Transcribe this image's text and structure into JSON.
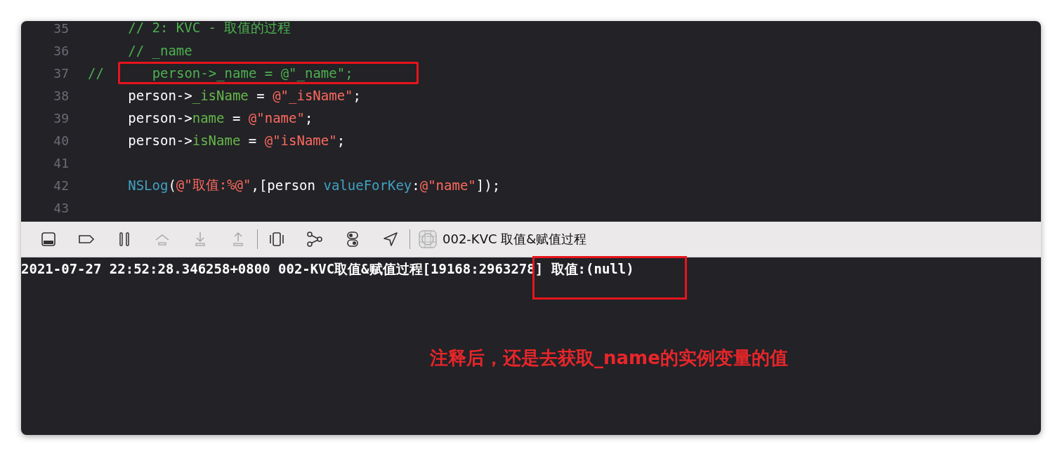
{
  "editor": {
    "lines": [
      {
        "number": "35",
        "tokens": [
          {
            "text": "     // 2: KVC - 取值的过程",
            "kind": "comment",
            "boxed": false
          }
        ]
      },
      {
        "number": "36",
        "tokens": [
          {
            "text": "     // _name",
            "kind": "comment",
            "boxed": false
          }
        ]
      },
      {
        "number": "37",
        "tokens": [
          {
            "text": "//",
            "kind": "comment",
            "boxed": false
          },
          {
            "text": "    person->_name = @\"_name\";",
            "kind": "comment",
            "boxed": true
          }
        ]
      },
      {
        "number": "38",
        "tokens": [
          {
            "text": "     person->",
            "kind": "plain",
            "boxed": false
          },
          {
            "text": "_isName",
            "kind": "member",
            "boxed": false
          },
          {
            "text": " = ",
            "kind": "plain",
            "boxed": false
          },
          {
            "text": "@\"_isName\"",
            "kind": "string",
            "boxed": false
          },
          {
            "text": ";",
            "kind": "plain",
            "boxed": false
          }
        ]
      },
      {
        "number": "39",
        "tokens": [
          {
            "text": "     person->",
            "kind": "plain",
            "boxed": false
          },
          {
            "text": "name",
            "kind": "member",
            "boxed": false
          },
          {
            "text": " = ",
            "kind": "plain",
            "boxed": false
          },
          {
            "text": "@\"name\"",
            "kind": "string",
            "boxed": false
          },
          {
            "text": ";",
            "kind": "plain",
            "boxed": false
          }
        ]
      },
      {
        "number": "40",
        "tokens": [
          {
            "text": "     person->",
            "kind": "plain",
            "boxed": false
          },
          {
            "text": "isName",
            "kind": "member",
            "boxed": false
          },
          {
            "text": " = ",
            "kind": "plain",
            "boxed": false
          },
          {
            "text": "@\"isName\"",
            "kind": "string",
            "boxed": false
          },
          {
            "text": ";",
            "kind": "plain",
            "boxed": false
          }
        ]
      },
      {
        "number": "41"
      },
      {
        "number": "42",
        "tokens": [
          {
            "text": "     NSLog",
            "kind": "function",
            "boxed": false
          },
          {
            "text": "(",
            "kind": "plain",
            "boxed": false
          },
          {
            "text": "@\"取值:%@\"",
            "kind": "string",
            "boxed": false
          },
          {
            "text": ",[person ",
            "kind": "plain",
            "boxed": false
          },
          {
            "text": "valueForKey",
            "kind": "function",
            "boxed": false
          },
          {
            "text": ":",
            "kind": "plain",
            "boxed": false
          },
          {
            "text": "@\"name\"",
            "kind": "string",
            "boxed": false
          },
          {
            "text": "]);",
            "kind": "plain",
            "boxed": false
          }
        ]
      },
      {
        "number": "43"
      }
    ]
  },
  "toolbar": {
    "button_groups": [
      [
        {
          "disabled": false
        },
        {
          "disabled": false
        },
        {
          "disabled": false
        },
        {
          "disabled": true
        },
        {
          "disabled": true
        },
        {
          "disabled": true
        }
      ],
      [
        {
          "disabled": false
        },
        {
          "disabled": false
        },
        {
          "disabled": false
        },
        {
          "disabled": false
        }
      ]
    ],
    "target": "002-KVC 取值&赋值过程"
  },
  "console": {
    "log_prefix": "2021-07-27 22:52:28.346258+0800 002-KVC取值&赋值过程[19168:2963278",
    "log_boxed": "] 取值:(null)"
  },
  "annotation": "注释后，还是去获取_name的实例变量的值"
}
